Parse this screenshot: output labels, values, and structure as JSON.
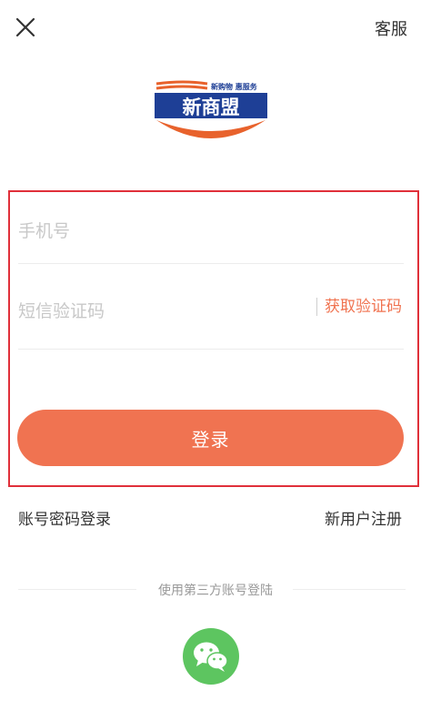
{
  "header": {
    "service_label": "客服"
  },
  "logo": {
    "name": "新商盟",
    "slogan": "新购物 惠服务"
  },
  "form": {
    "phone_placeholder": "手机号",
    "code_placeholder": "短信验证码",
    "get_code_label": "获取验证码",
    "login_label": "登录"
  },
  "links": {
    "account_login": "账号密码登录",
    "register": "新用户注册"
  },
  "third_party": {
    "label": "使用第三方账号登陆",
    "wechat_icon": "wechat-icon"
  },
  "colors": {
    "accent": "#f07351",
    "highlight_border": "#e0303a",
    "wechat": "#5dc560",
    "brand_blue": "#1e3f96",
    "brand_orange": "#e8622c"
  }
}
